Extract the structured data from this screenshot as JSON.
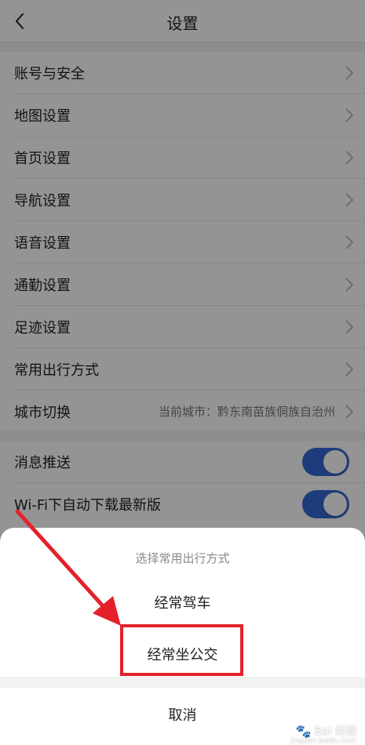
{
  "header": {
    "title": "设置"
  },
  "settings": {
    "items": [
      {
        "label": "账号与安全"
      },
      {
        "label": "地图设置"
      },
      {
        "label": "首页设置"
      },
      {
        "label": "导航设置"
      },
      {
        "label": "语音设置"
      },
      {
        "label": "通勤设置"
      },
      {
        "label": "足迹设置"
      },
      {
        "label": "常用出行方式"
      },
      {
        "label": "城市切换",
        "value": "当前城市：黔东南苗族侗族自治州"
      }
    ],
    "toggles": [
      {
        "label": "消息推送",
        "on": true
      },
      {
        "label": "Wi-Fi下自动下载最新版",
        "on": true
      }
    ]
  },
  "sheet": {
    "title": "选择常用出行方式",
    "options": [
      {
        "label": "经常驾车"
      },
      {
        "label": "经常坐公交"
      }
    ],
    "cancel": "取消"
  },
  "colors": {
    "accent": "#3568d4",
    "highlight": "#e4212b"
  },
  "watermark": {
    "text": "Bai 经验",
    "sub": "jingyan.baidu.com"
  }
}
